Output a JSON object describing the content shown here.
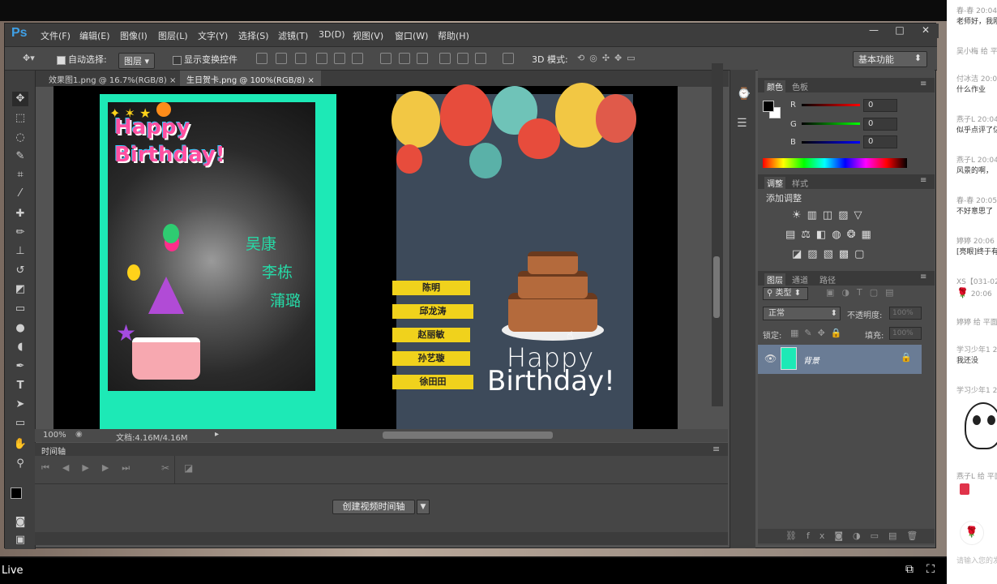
{
  "ps": {
    "logo": "Ps",
    "menus": [
      "文件(F)",
      "编辑(E)",
      "图像(I)",
      "图层(L)",
      "文字(Y)",
      "选择(S)",
      "滤镜(T)",
      "3D(D)",
      "视图(V)",
      "窗口(W)",
      "帮助(H)"
    ],
    "window_controls": [
      "—",
      "□",
      "✕"
    ],
    "options": {
      "auto_select_label": "自动选择:",
      "auto_select_value": "图层",
      "show_transform_label": "显示变换控件",
      "mode_3d_label": "3D 模式:",
      "workspace": "基本功能"
    },
    "tabs": [
      {
        "label": "效果图1.png @ 16.7%(RGB/8)",
        "close": "×"
      },
      {
        "label": "生日贺卡.png @ 100%(RGB/8)",
        "close": "×"
      }
    ],
    "status": {
      "zoom": "100%",
      "doc": "文档:4.16M/4.16M"
    },
    "timeline": {
      "title": "时间轴",
      "create_button": "创建视频时间轴"
    }
  },
  "card1": {
    "title": "Happy Birthday!",
    "names": [
      "吴康",
      "李栋",
      "蒲璐"
    ]
  },
  "card2": {
    "names": [
      "陈明",
      "邱龙涛",
      "赵丽敏",
      "孙艺璇",
      "徐田田"
    ],
    "greeting_line1": "Happy",
    "greeting_line2": "Birthday!"
  },
  "panels": {
    "color_tabs": [
      "颜色",
      "色板"
    ],
    "rgb": [
      {
        "label": "R",
        "value": "0"
      },
      {
        "label": "G",
        "value": "0"
      },
      {
        "label": "B",
        "value": "0"
      }
    ],
    "adjust_tabs": [
      "调整",
      "样式"
    ],
    "adjust_title": "添加调整",
    "layer_tabs": [
      "图层",
      "通道",
      "路径"
    ],
    "layer_filter": "类型",
    "blend_mode": "正常",
    "opacity_label": "不透明度:",
    "opacity_value": "100%",
    "lock_label": "锁定:",
    "fill_label": "填充:",
    "fill_value": "100%",
    "layer_name": "背景"
  },
  "live": {
    "label": "Live"
  },
  "chat": {
    "messages": [
      {
        "user": "春-春 20:04",
        "text": "老师好，我刚"
      },
      {
        "user": "吴小梅 给 平",
        "text": ""
      },
      {
        "user": "付冰洁 20:04",
        "text": "什么作业"
      },
      {
        "user": "燕子L 20:04",
        "text": "似乎点评了亿"
      },
      {
        "user": "燕子L 20:04",
        "text": "风景的啊，"
      },
      {
        "user": "春-春 20:05",
        "text": "不好意思了"
      },
      {
        "user": "婷婷 20:06",
        "text": "[亮眼]终于有"
      },
      {
        "user": "XS【031-02",
        "text": ""
      },
      {
        "user": "20:06",
        "text": ""
      },
      {
        "user": "婷婷 给 平面",
        "text": ""
      },
      {
        "user": "学习少年1 2(",
        "text": "我还没"
      },
      {
        "user": "学习少年1 2(",
        "text": ""
      },
      {
        "user": "燕子L 给 平面",
        "text": ""
      }
    ],
    "input_placeholder": "请输入您的发"
  },
  "colors": {
    "card1_bg": "#1de9b6",
    "card2_bg": "#3d4a5a",
    "tag_yellow": "#f0d21c",
    "ps_accent": "#3fa0e6"
  }
}
